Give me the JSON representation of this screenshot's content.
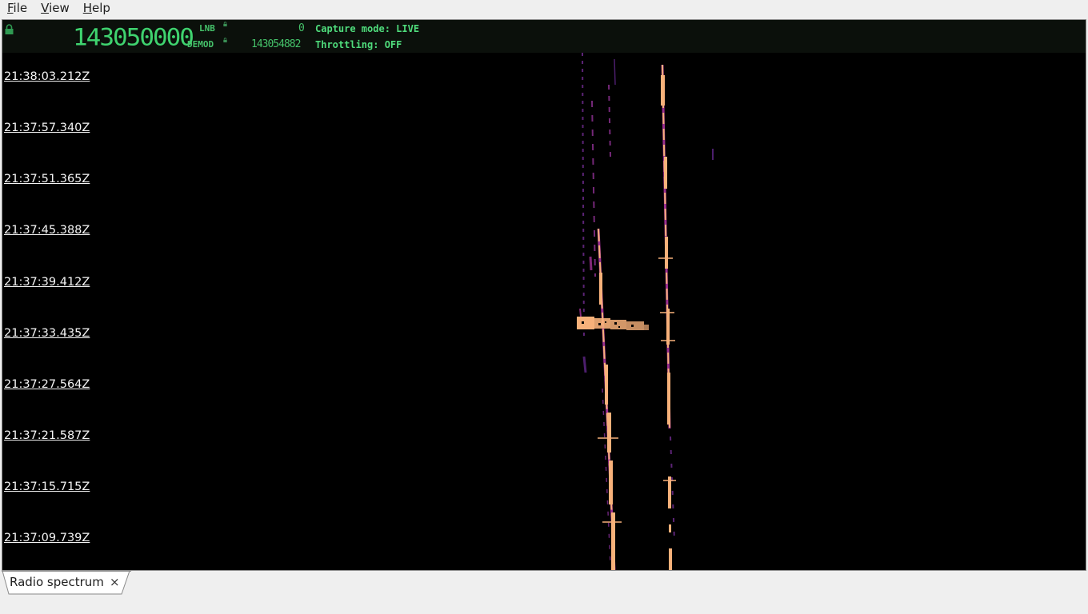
{
  "menu": {
    "items": [
      {
        "label_mn": "F",
        "label_rest": "ile"
      },
      {
        "label_mn": "V",
        "label_rest": "iew"
      },
      {
        "label_mn": "H",
        "label_rest": "elp"
      }
    ]
  },
  "status": {
    "frequency": "143050000",
    "lnb_label": "LNB",
    "lnb_value": "0",
    "demod_label": "DEMOD",
    "demod_value": "143054882",
    "capture_mode": "Capture mode: LIVE",
    "throttling": "Throttling: OFF",
    "colors": {
      "digits": "#3fd36f",
      "text": "#4fdc7c",
      "background": "#0b100b"
    }
  },
  "waterfall": {
    "timestamps": [
      "21:38:03.212Z",
      "21:37:57.340Z",
      "21:37:51.365Z",
      "21:37:45.388Z",
      "21:37:39.412Z",
      "21:37:33.435Z",
      "21:37:27.564Z",
      "21:37:21.587Z",
      "21:37:15.715Z",
      "21:37:09.739Z"
    ],
    "colors": {
      "strong": "#f7b17a",
      "weak": "#9b2f8f",
      "faint": "#4a1d6e"
    }
  },
  "tabs": [
    {
      "label": "Radio spectrum",
      "close": "×"
    }
  ]
}
